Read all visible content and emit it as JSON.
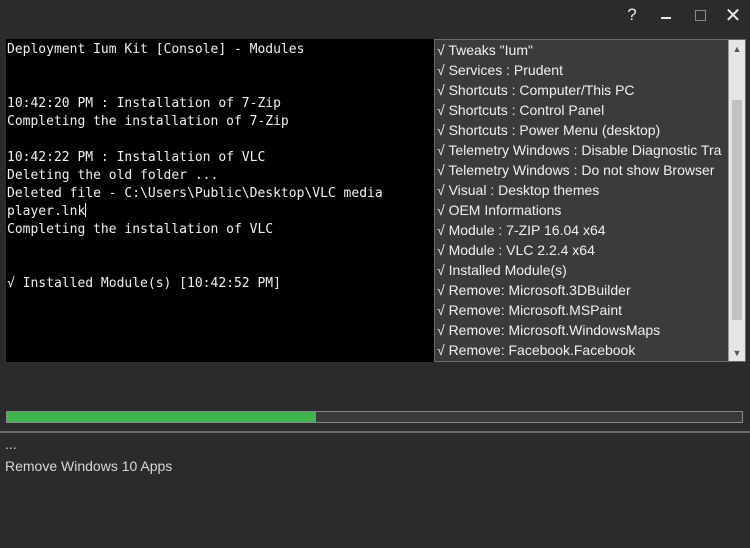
{
  "title_bar": {
    "help_glyph": "?",
    "close_glyph": "✕"
  },
  "console": {
    "lines": [
      "Deployment Ium Kit [Console] - Modules",
      "",
      "",
      "10:42:20 PM : Installation of 7-Zip",
      "Completing the installation of 7-Zip",
      "",
      "10:42:22 PM : Installation of VLC",
      "Deleting the old folder ...",
      "Deleted file - C:\\Users\\Public\\Desktop\\VLC media",
      "player.lnk",
      "Completing the installation of VLC",
      "",
      "",
      "√ Installed Module(s) [10:42:52 PM]"
    ]
  },
  "task_list": {
    "items": [
      "√ Tweaks \"Ium\"",
      "√ Services : Prudent",
      "√ Shortcuts : Computer/This PC",
      "√ Shortcuts : Control Panel",
      "√ Shortcuts : Power Menu (desktop)",
      "√ Telemetry Windows : Disable Diagnostic Tra",
      "√ Telemetry Windows : Do not show Browser",
      "√ Visual : Desktop themes",
      "√ OEM Informations",
      "√ Module : 7-ZIP 16.04 x64",
      "√ Module : VLC 2.2.4 x64",
      "√ Installed Module(s)",
      "√ Remove: Microsoft.3DBuilder",
      "√ Remove: Microsoft.MSPaint",
      "√ Remove: Microsoft.WindowsMaps",
      "√ Remove: Facebook.Facebook"
    ]
  },
  "progress": {
    "fraction": 0.42,
    "color": "#3fb54f"
  },
  "status": {
    "dots": "...",
    "text": "Remove Windows 10 Apps"
  }
}
